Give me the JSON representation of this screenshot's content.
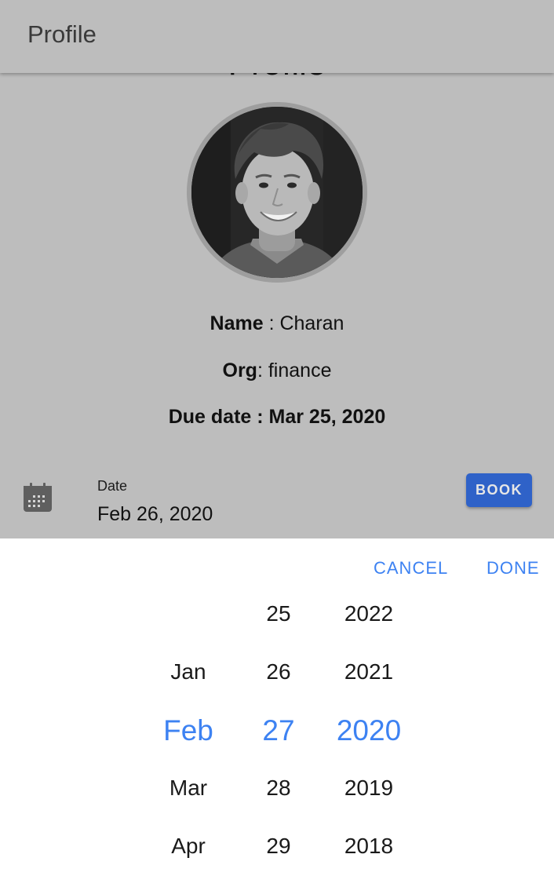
{
  "appbar": {
    "title": "Profile"
  },
  "page": {
    "heading": "Profile"
  },
  "profile": {
    "name_label": "Name",
    "name_separator": " : ",
    "name_value": "Charan",
    "org_label": "Org",
    "org_separator": ": ",
    "org_value": "finance",
    "due_date": "Due date : Mar 25, 2020"
  },
  "date_field": {
    "label": "Date",
    "value": "Feb 26, 2020",
    "icon": "calendar-icon"
  },
  "book_button": {
    "label": "BOOK"
  },
  "picker": {
    "cancel_label": "CANCEL",
    "done_label": "DONE",
    "months": [
      "",
      "Jan",
      "Feb",
      "Mar",
      "Apr"
    ],
    "days": [
      "25",
      "26",
      "27",
      "28",
      "29"
    ],
    "years": [
      "2022",
      "2021",
      "2020",
      "2019",
      "2018"
    ],
    "selected": {
      "month": "Feb",
      "day": "27",
      "year": "2020"
    }
  },
  "colors": {
    "accent": "#3d82f2",
    "button": "#2f62c8",
    "scrim": "#bdbdbd"
  }
}
